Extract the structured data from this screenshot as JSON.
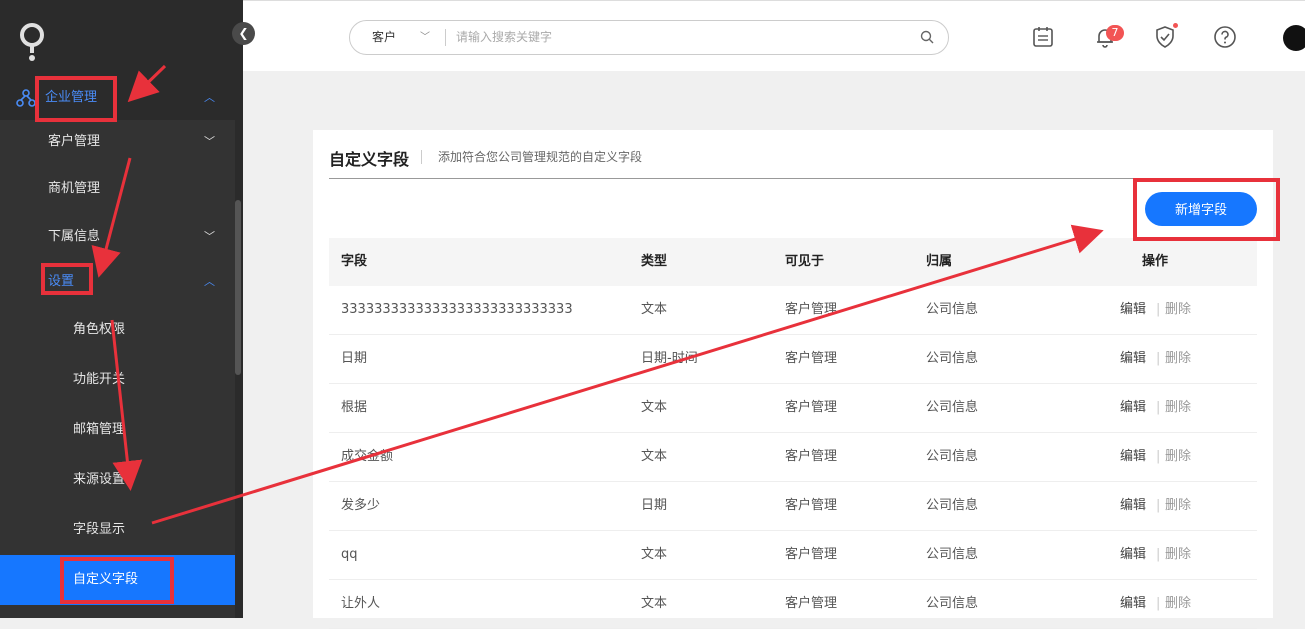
{
  "sidebar": {
    "items": [
      {
        "label": "企业管理"
      },
      {
        "label": "客户管理"
      },
      {
        "label": "商机管理"
      },
      {
        "label": "下属信息"
      },
      {
        "label": "设置"
      },
      {
        "label": "角色权限"
      },
      {
        "label": "功能开关"
      },
      {
        "label": "邮箱管理"
      },
      {
        "label": "来源设置"
      },
      {
        "label": "字段显示"
      },
      {
        "label": "自定义字段"
      }
    ]
  },
  "header": {
    "search": {
      "scope": "客户",
      "placeholder": "请输入搜索关键字"
    },
    "notification_count": "7"
  },
  "main": {
    "title": "自定义字段",
    "description": "添加符合您公司管理规范的自定义字段",
    "add_button": "新增字段",
    "columns": [
      "字段",
      "类型",
      "可见于",
      "归属",
      "操作"
    ],
    "rows": [
      {
        "field": "3333333333333333333333333333",
        "type": "文本",
        "visible": "客户管理",
        "owner": "公司信息"
      },
      {
        "field": "日期",
        "type": "日期-时间",
        "visible": "客户管理",
        "owner": "公司信息"
      },
      {
        "field": "根据",
        "type": "文本",
        "visible": "客户管理",
        "owner": "公司信息"
      },
      {
        "field": "成交金额",
        "type": "文本",
        "visible": "客户管理",
        "owner": "公司信息"
      },
      {
        "field": "发多少",
        "type": "日期",
        "visible": "客户管理",
        "owner": "公司信息"
      },
      {
        "field": "qq",
        "type": "文本",
        "visible": "客户管理",
        "owner": "公司信息"
      },
      {
        "field": "让外人",
        "type": "文本",
        "visible": "客户管理",
        "owner": "公司信息"
      }
    ],
    "actions": {
      "edit": "编辑",
      "separator": "|",
      "delete": "删除"
    }
  },
  "icons": [
    "logo-icon",
    "collapse-icon",
    "org-icon",
    "chevron-icon",
    "search-icon",
    "calendar-icon",
    "bell-icon",
    "shield-icon",
    "help-icon"
  ],
  "colors": {
    "accent": "#1677ff",
    "sidebar": "#2b2b2b",
    "annotation": "#e8313b",
    "badge": "#f25454"
  }
}
